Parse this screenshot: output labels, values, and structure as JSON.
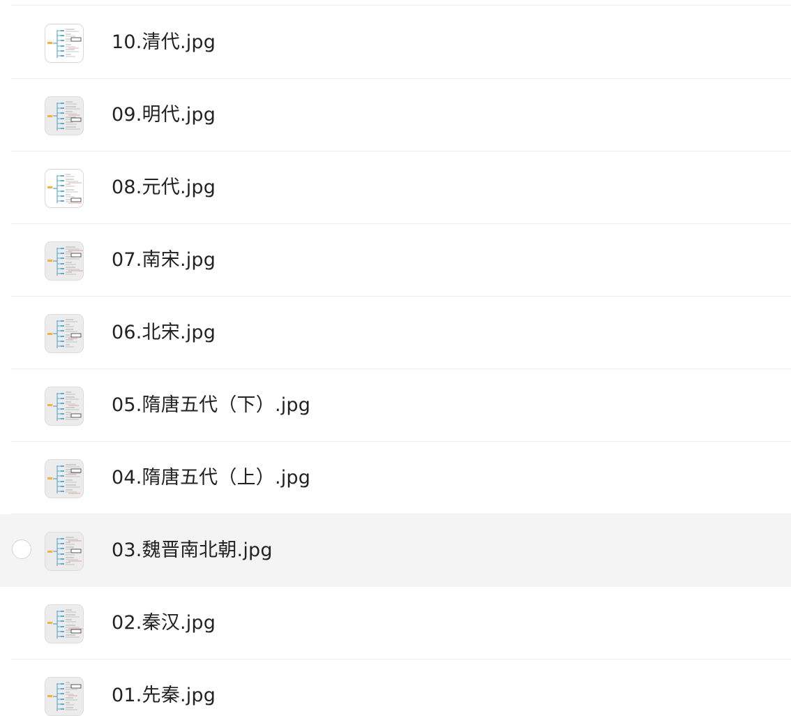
{
  "files": [
    {
      "name": "10.清代.jpg",
      "thumb_style": "light",
      "selected": false
    },
    {
      "name": "09.明代.jpg",
      "thumb_style": "gray",
      "selected": false
    },
    {
      "name": "08.元代.jpg",
      "thumb_style": "light",
      "selected": false
    },
    {
      "name": "07.南宋.jpg",
      "thumb_style": "gray",
      "selected": false
    },
    {
      "name": "06.北宋.jpg",
      "thumb_style": "gray",
      "selected": false
    },
    {
      "name": "05.隋唐五代（下）.jpg",
      "thumb_style": "gray",
      "selected": false
    },
    {
      "name": "04.隋唐五代（上）.jpg",
      "thumb_style": "gray",
      "selected": false
    },
    {
      "name": "03.魏晋南北朝.jpg",
      "thumb_style": "gray",
      "selected": true
    },
    {
      "name": "02.秦汉.jpg",
      "thumb_style": "gray",
      "selected": false
    },
    {
      "name": "01.先秦.jpg",
      "thumb_style": "gray",
      "selected": false
    }
  ],
  "thumbnail_icon": "mind-map-thumbnail",
  "colors": {
    "selected_row_bg": "#f4f4f4",
    "divider": "#ededed",
    "text": "#222222",
    "mindmap_blue": "#5aa9d6",
    "mindmap_orange": "#f0b34a",
    "mindmap_red": "#d9534f"
  }
}
